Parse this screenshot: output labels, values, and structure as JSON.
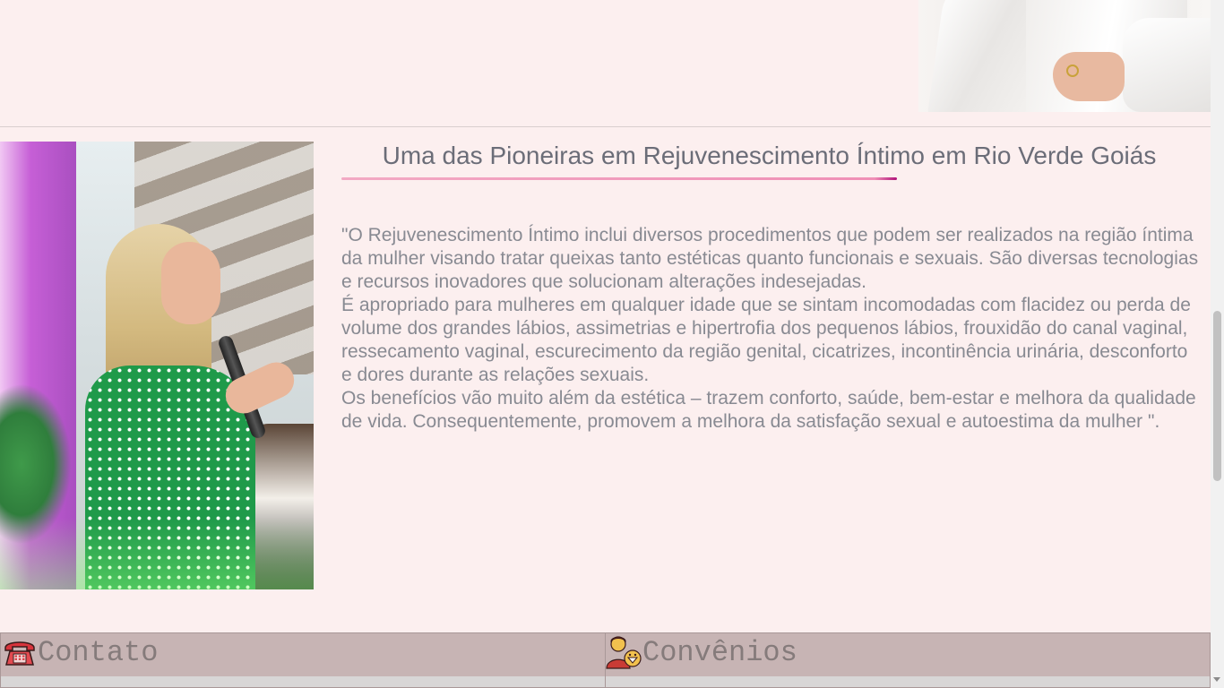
{
  "article": {
    "title": "Uma das Pioneiras em Rejuvenescimento Íntimo em Rio Verde Goiás",
    "paragraphs": [
      "\"O Rejuvenescimento Íntimo inclui diversos procedimentos que podem ser realizados na região íntima da mulher visando tratar queixas tanto estéticas quanto funcionais e sexuais. São diversas tecnologias e recursos inovadores que solucionam alterações indesejadas.",
      "É apropriado para mulheres em qualquer idade que se sintam incomodadas com flacidez ou perda de volume dos grandes lábios, assimetrias e hipertrofia dos pequenos lábios, frouxidão do canal vaginal, ressecamento vaginal, escurecimento da região genital, cicatrizes, incontinência urinária, desconforto e dores durante as relações sexuais.",
      "Os benefícios vão muito além da estética – trazem conforto, saúde, bem-estar e melhora da qualidade de vida. Consequentemente, promovem a melhora da satisfação sexual e autoestima da mulher \"."
    ]
  },
  "footer": {
    "contato_label": "Contato",
    "convenios_label": "Convênios"
  },
  "icons": {
    "contato": "telephone-icon",
    "convenios": "agent-icon"
  },
  "colors": {
    "background": "#fcefef",
    "title_text": "#6b6d78",
    "body_text": "#888a92",
    "underline": "#f08fb6",
    "footer_panel": "#c7b4b4"
  }
}
